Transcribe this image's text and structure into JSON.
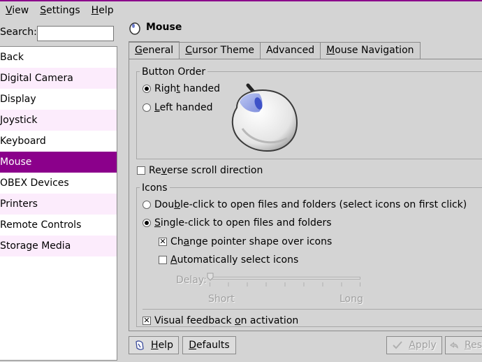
{
  "menubar": {
    "items": [
      {
        "pre": "",
        "u": "V",
        "post": "iew"
      },
      {
        "pre": "",
        "u": "S",
        "post": "ettings"
      },
      {
        "pre": "",
        "u": "H",
        "post": "elp"
      }
    ]
  },
  "search": {
    "label": "Search:",
    "value": ""
  },
  "sidebar": {
    "items": [
      "Back",
      "Digital Camera",
      "Display",
      "Joystick",
      "Keyboard",
      "Mouse",
      "OBEX Devices",
      "Printers",
      "Remote Controls",
      "Storage Media"
    ],
    "selected": "Mouse"
  },
  "page": {
    "title": "Mouse"
  },
  "tabs": [
    {
      "pre": "",
      "u": "G",
      "post": "eneral",
      "active": true
    },
    {
      "pre": "",
      "u": "C",
      "post": "ursor Theme",
      "active": false
    },
    {
      "pre": "",
      "u": "",
      "post": "Advanced",
      "active": false
    },
    {
      "pre": "",
      "u": "M",
      "post": "ouse Navigation",
      "active": false
    }
  ],
  "button_order": {
    "title": "Button Order",
    "right": {
      "pre": "Righ",
      "u": "t",
      "post": " handed",
      "checked": true
    },
    "left": {
      "pre": "",
      "u": "L",
      "post": "eft handed",
      "checked": false
    }
  },
  "reverse_scroll": {
    "pre": "Re",
    "u": "v",
    "post": "erse scroll direction",
    "checked": false
  },
  "icons_group": {
    "title": "Icons",
    "double_click": {
      "pre": "Dou",
      "u": "b",
      "post": "le-click to open files and folders (select icons on first click)",
      "checked": false
    },
    "single_click": {
      "pre": "",
      "u": "S",
      "post": "ingle-click to open files and folders",
      "checked": true
    },
    "change_pointer": {
      "pre": "Ch",
      "u": "a",
      "post": "nge pointer shape over icons",
      "checked": true
    },
    "auto_select": {
      "pre": "",
      "u": "A",
      "post": "utomatically select icons",
      "checked": false
    },
    "delay": {
      "label": "Delay:",
      "min_label": "Short",
      "max_label": "Long",
      "value": 0
    }
  },
  "visual_feedback": {
    "pre": "Visual feedback ",
    "u": "o",
    "post": "n activation",
    "checked": true
  },
  "buttons": {
    "help": {
      "pre": "",
      "u": "H",
      "post": "elp"
    },
    "defaults": {
      "pre": "",
      "u": "D",
      "post": "efaults"
    },
    "apply": {
      "pre": "",
      "u": "A",
      "post": "pply"
    },
    "reset": {
      "pre": "",
      "u": "R",
      "post": "es"
    }
  },
  "colors": {
    "accent": "#8b008b",
    "sidebar_alt": "#fcecfc",
    "window_bg": "#d4d4d4"
  }
}
